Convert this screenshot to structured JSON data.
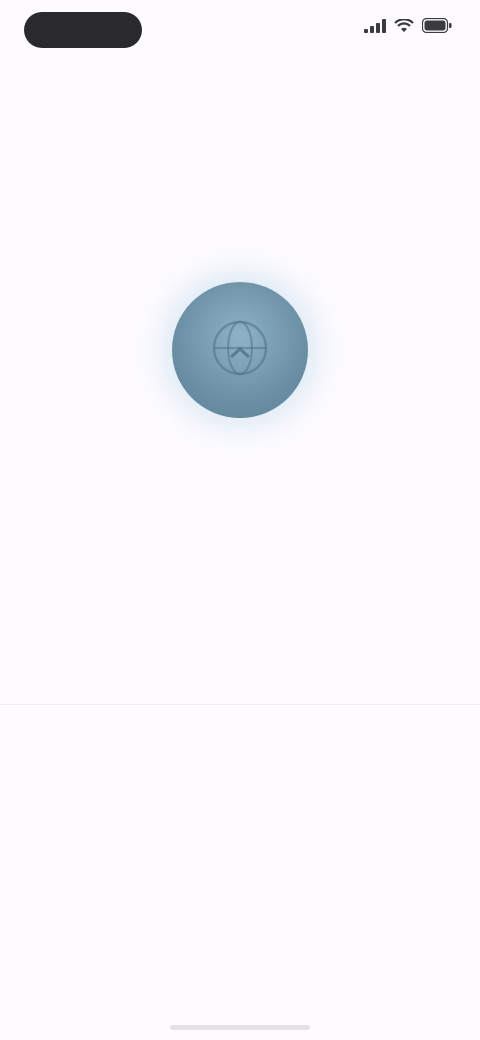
{
  "status_bar": {
    "time": "",
    "icons": [
      "signal-icon",
      "wifi-icon",
      "battery-icon"
    ]
  },
  "main": {
    "illustration_icon": "globe-icon",
    "title": "",
    "subtitle": "",
    "secondary_link": "",
    "footer_link": ""
  },
  "colors": {
    "background": "#fdfbfe",
    "accent": "#6e93a8",
    "title": "#2f2f33",
    "subtitle": "#8a8890"
  }
}
